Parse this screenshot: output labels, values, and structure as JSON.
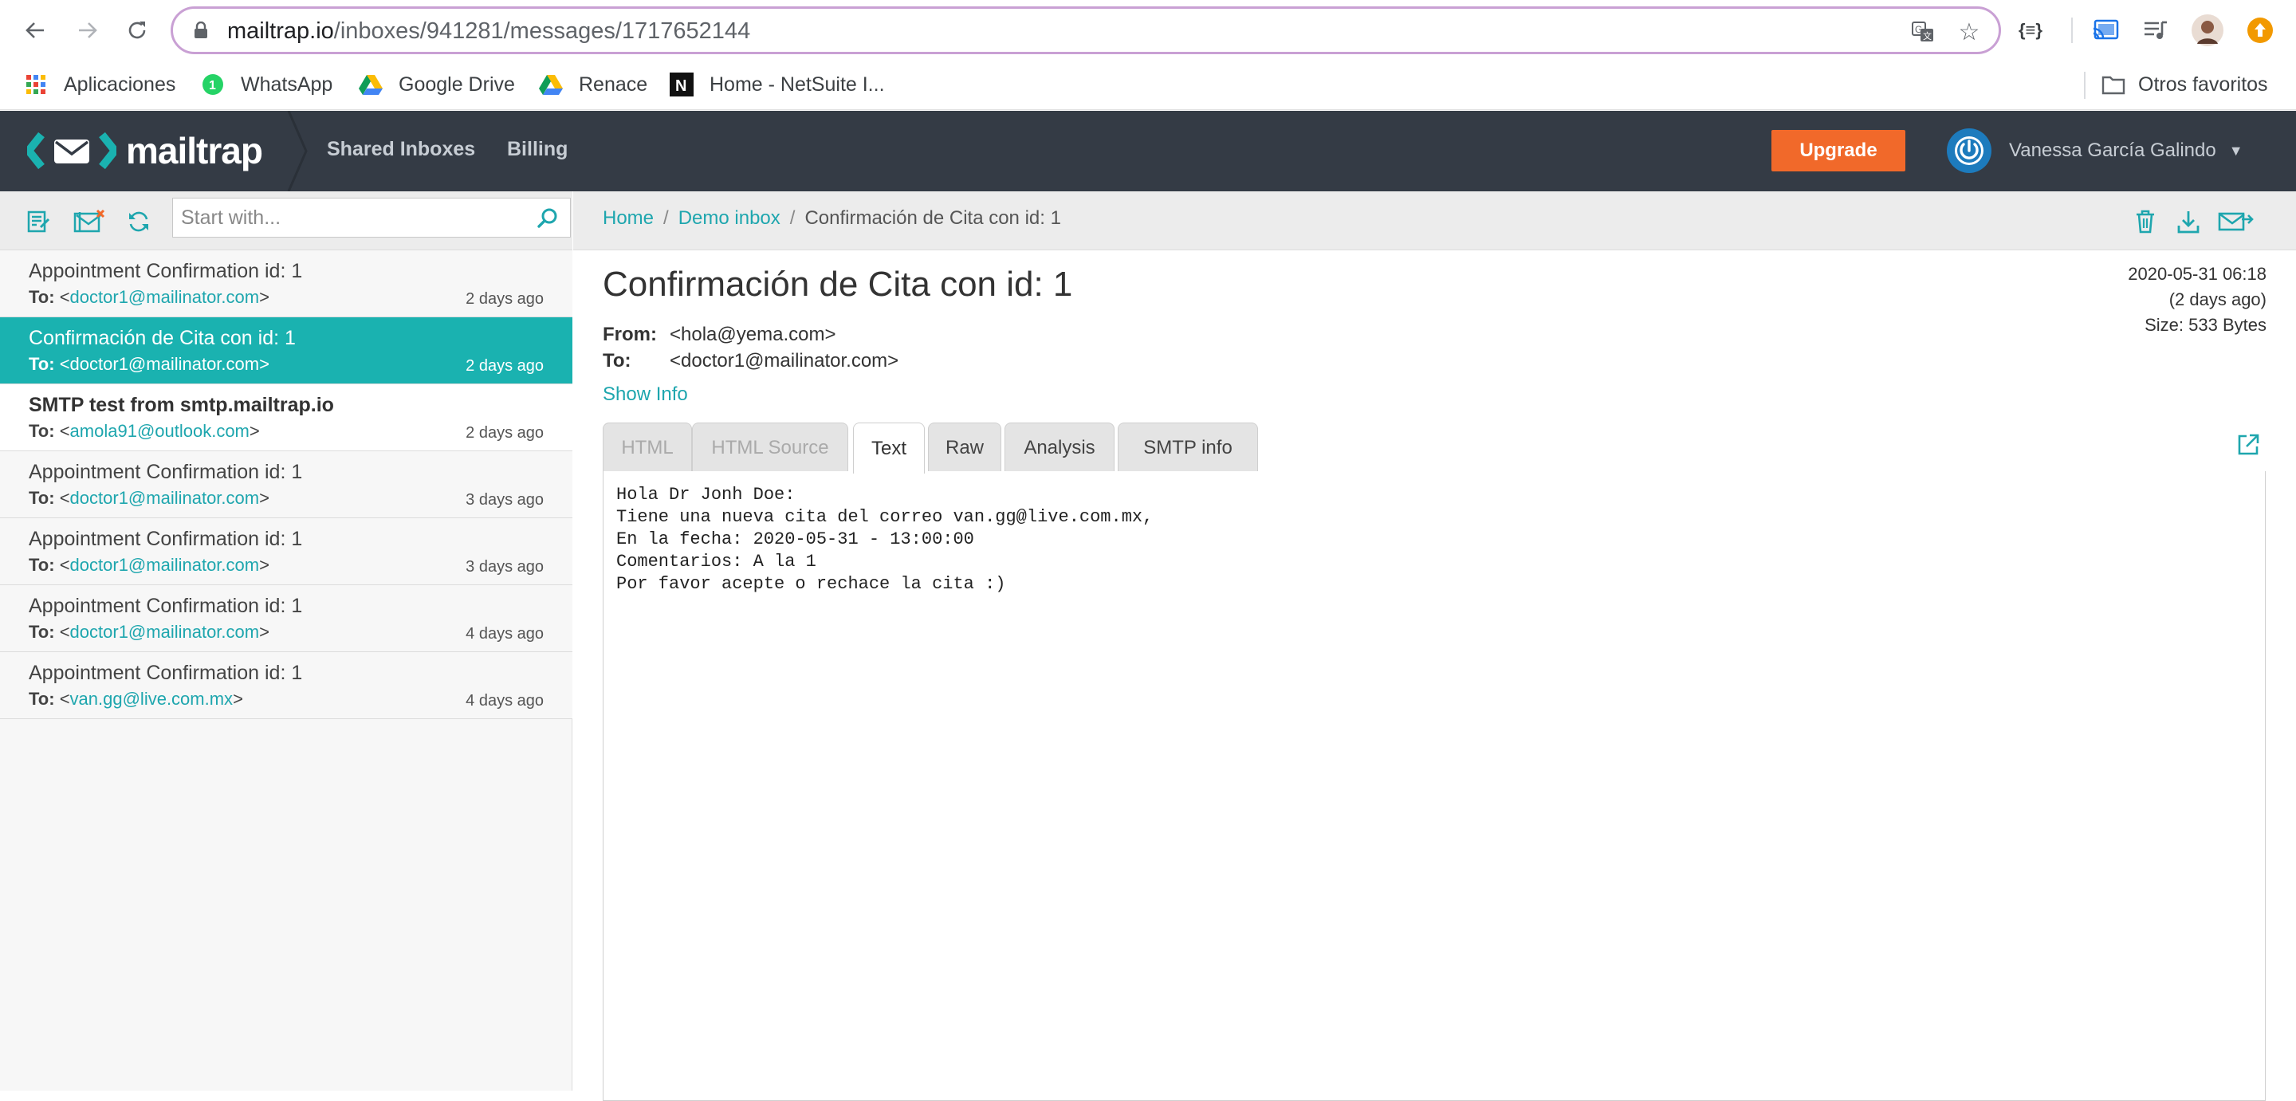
{
  "browser": {
    "url_host": "mailtrap.io",
    "url_path": "/inboxes/941281/messages/1717652144",
    "bookmarks": [
      {
        "label": "Aplicaciones",
        "icon": "apps-grid-icon"
      },
      {
        "label": "WhatsApp",
        "icon": "whatsapp-icon"
      },
      {
        "label": "Google Drive",
        "icon": "google-drive-icon"
      },
      {
        "label": "Renace",
        "icon": "google-drive-icon"
      },
      {
        "label": "Home - NetSuite I...",
        "icon": "netsuite-icon"
      }
    ],
    "other_bookmarks": "Otros favoritos",
    "json_ext_label": "{≡}"
  },
  "header": {
    "brand": "mailtrap",
    "nav": [
      "Shared Inboxes",
      "Billing"
    ],
    "upgrade_label": "Upgrade",
    "user_name": "Vanessa García Galindo"
  },
  "sidebar": {
    "search_placeholder": "Start with...",
    "messages": [
      {
        "subject": "Appointment Confirmation id: 1",
        "to_label": "To:",
        "to": "doctor1@mailinator.com",
        "ago": "2 days ago",
        "state": "read"
      },
      {
        "subject": "Confirmación de Cita con id: 1",
        "to_label": "To:",
        "to": "doctor1@mailinator.com",
        "ago": "2 days ago",
        "state": "active"
      },
      {
        "subject": "SMTP test from smtp.mailtrap.io",
        "to_label": "To:",
        "to": "amola91@outlook.com",
        "ago": "2 days ago",
        "state": "unread"
      },
      {
        "subject": "Appointment Confirmation id: 1",
        "to_label": "To:",
        "to": "doctor1@mailinator.com",
        "ago": "3 days ago",
        "state": "read"
      },
      {
        "subject": "Appointment Confirmation id: 1",
        "to_label": "To:",
        "to": "doctor1@mailinator.com",
        "ago": "3 days ago",
        "state": "read"
      },
      {
        "subject": "Appointment Confirmation id: 1",
        "to_label": "To:",
        "to": "doctor1@mailinator.com",
        "ago": "4 days ago",
        "state": "read"
      },
      {
        "subject": "Appointment Confirmation id: 1",
        "to_label": "To:",
        "to": "van.gg@live.com.mx",
        "ago": "4 days ago",
        "state": "read"
      }
    ]
  },
  "main": {
    "breadcrumb": [
      "Home",
      "Demo inbox",
      "Confirmación de Cita con id: 1"
    ],
    "subject": "Confirmación de Cita con id: 1",
    "from_label": "From:",
    "from": "<hola@yema.com>",
    "to_label": "To:",
    "to": "<doctor1@mailinator.com>",
    "show_info": "Show Info",
    "date": "2020-05-31 06:18",
    "relative": "(2 days ago)",
    "size": "Size: 533 Bytes",
    "tabs": [
      {
        "label": "HTML",
        "state": "disabled"
      },
      {
        "label": "HTML Source",
        "state": "disabled"
      },
      {
        "label": "Text",
        "state": "active"
      },
      {
        "label": "Raw",
        "state": "normal"
      },
      {
        "label": "Analysis",
        "state": "normal"
      },
      {
        "label": "SMTP info",
        "state": "normal"
      }
    ],
    "body_text": "Hola Dr Jonh Doe:\nTiene una nueva cita del correo van.gg@live.com.mx,\nEn la fecha: 2020-05-31 - 13:00:00\nComentarios: A la 1\nPor favor acepte o rechace la cita :)"
  },
  "colors": {
    "accent": "#1ab2b0",
    "header_bg": "#343b45",
    "upgrade": "#f1692a",
    "link": "#1ea6ae"
  }
}
